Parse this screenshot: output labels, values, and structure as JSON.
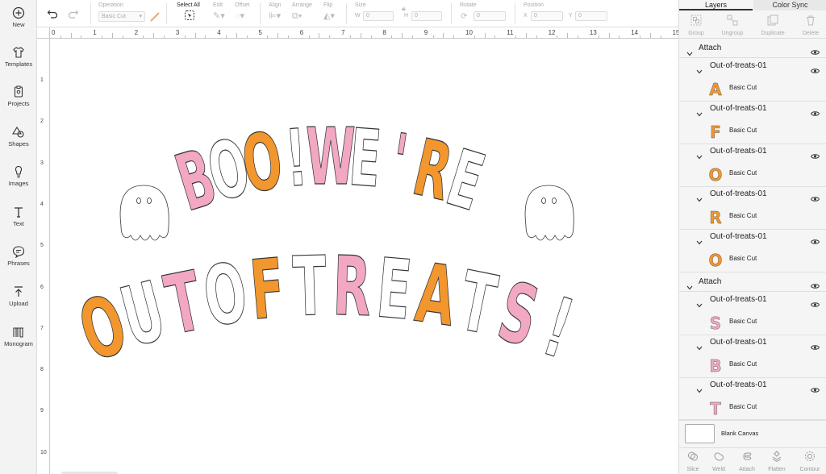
{
  "sidebar": {
    "items": [
      {
        "label": "New",
        "icon": "plus-circle-icon"
      },
      {
        "label": "Templates",
        "icon": "shirt-icon"
      },
      {
        "label": "Projects",
        "icon": "projects-icon"
      },
      {
        "label": "Shapes",
        "icon": "shapes-icon"
      },
      {
        "label": "Images",
        "icon": "lightbulb-icon"
      },
      {
        "label": "Text",
        "icon": "text-icon"
      },
      {
        "label": "Phrases",
        "icon": "speech-bubble-icon"
      },
      {
        "label": "Upload",
        "icon": "upload-icon"
      },
      {
        "label": "Monogram",
        "icon": "monogram-icon"
      }
    ]
  },
  "toolbar": {
    "operation_label": "Operation",
    "operation_value": "Basic Cut",
    "select_all_label": "Select All",
    "edit_label": "Edit",
    "offset_label": "Offset",
    "align_label": "Align",
    "arrange_label": "Arrange",
    "flip_label": "Flip",
    "size_label": "Size",
    "w_label": "W",
    "h_label": "H",
    "w_value": "0",
    "h_value": "0",
    "rotate_label": "Rotate",
    "rotate_value": "0",
    "position_label": "Position",
    "x_label": "X",
    "y_label": "Y",
    "x_value": "0",
    "y_value": "0"
  },
  "ruler": {
    "h_numbers": [
      "0",
      "1",
      "2",
      "3",
      "4",
      "5",
      "6",
      "7",
      "8",
      "9",
      "10",
      "11",
      "12",
      "13",
      "14",
      "15"
    ],
    "v_numbers": [
      "1",
      "2",
      "3",
      "4",
      "5",
      "6",
      "7",
      "8",
      "9",
      "10"
    ]
  },
  "panel": {
    "tabs": [
      "Layers",
      "Color Sync"
    ],
    "actions": [
      "Group",
      "Ungroup",
      "Duplicate",
      "Delete"
    ],
    "groups": [
      {
        "name": "Attach",
        "layers": [
          {
            "name": "Out-of-treats-01",
            "operation": "Basic Cut",
            "glyph": "A",
            "color": "#f2962e"
          },
          {
            "name": "Out-of-treats-01",
            "operation": "Basic Cut",
            "glyph": "F",
            "color": "#f2962e"
          },
          {
            "name": "Out-of-treats-01",
            "operation": "Basic Cut",
            "glyph": "O",
            "color": "#f2962e"
          },
          {
            "name": "Out-of-treats-01",
            "operation": "Basic Cut",
            "glyph": "R",
            "color": "#f2962e"
          },
          {
            "name": "Out-of-treats-01",
            "operation": "Basic Cut",
            "glyph": "O",
            "color": "#f2962e"
          }
        ]
      },
      {
        "name": "Attach",
        "layers": [
          {
            "name": "Out-of-treats-01",
            "operation": "Basic Cut",
            "glyph": "S",
            "color": "#f2a7c3"
          },
          {
            "name": "Out-of-treats-01",
            "operation": "Basic Cut",
            "glyph": "B",
            "color": "#f2a7c3"
          },
          {
            "name": "Out-of-treats-01",
            "operation": "Basic Cut",
            "glyph": "T",
            "color": "#f2a7c3"
          }
        ]
      }
    ],
    "blank_canvas_label": "Blank Canvas",
    "bottom_actions": [
      "Slice",
      "Weld",
      "Attach",
      "Flatten",
      "Contour"
    ]
  },
  "design": {
    "line1": [
      {
        "ch": "B",
        "color": "#f2a7c3"
      },
      {
        "ch": "O",
        "color": "#ffffff"
      },
      {
        "ch": "O",
        "color": "#f2962e"
      },
      {
        "ch": "!",
        "color": "#ffffff"
      },
      {
        "ch": "W",
        "color": "#f2a7c3"
      },
      {
        "ch": "E",
        "color": "#ffffff"
      },
      {
        "ch": "'",
        "color": "#f2a7c3"
      },
      {
        "ch": "R",
        "color": "#f2962e"
      },
      {
        "ch": "E",
        "color": "#ffffff"
      }
    ],
    "line2": [
      {
        "ch": "O",
        "color": "#f2962e"
      },
      {
        "ch": "U",
        "color": "#ffffff"
      },
      {
        "ch": "T",
        "color": "#f2a7c3"
      },
      {
        "ch": "O",
        "color": "#ffffff"
      },
      {
        "ch": "F",
        "color": "#f2962e"
      },
      {
        "ch": "T",
        "color": "#ffffff"
      },
      {
        "ch": "R",
        "color": "#f2a7c3"
      },
      {
        "ch": "E",
        "color": "#ffffff"
      },
      {
        "ch": "A",
        "color": "#f2962e"
      },
      {
        "ch": "T",
        "color": "#ffffff"
      },
      {
        "ch": "S",
        "color": "#f2a7c3"
      },
      {
        "ch": "!",
        "color": "#ffffff"
      }
    ]
  }
}
